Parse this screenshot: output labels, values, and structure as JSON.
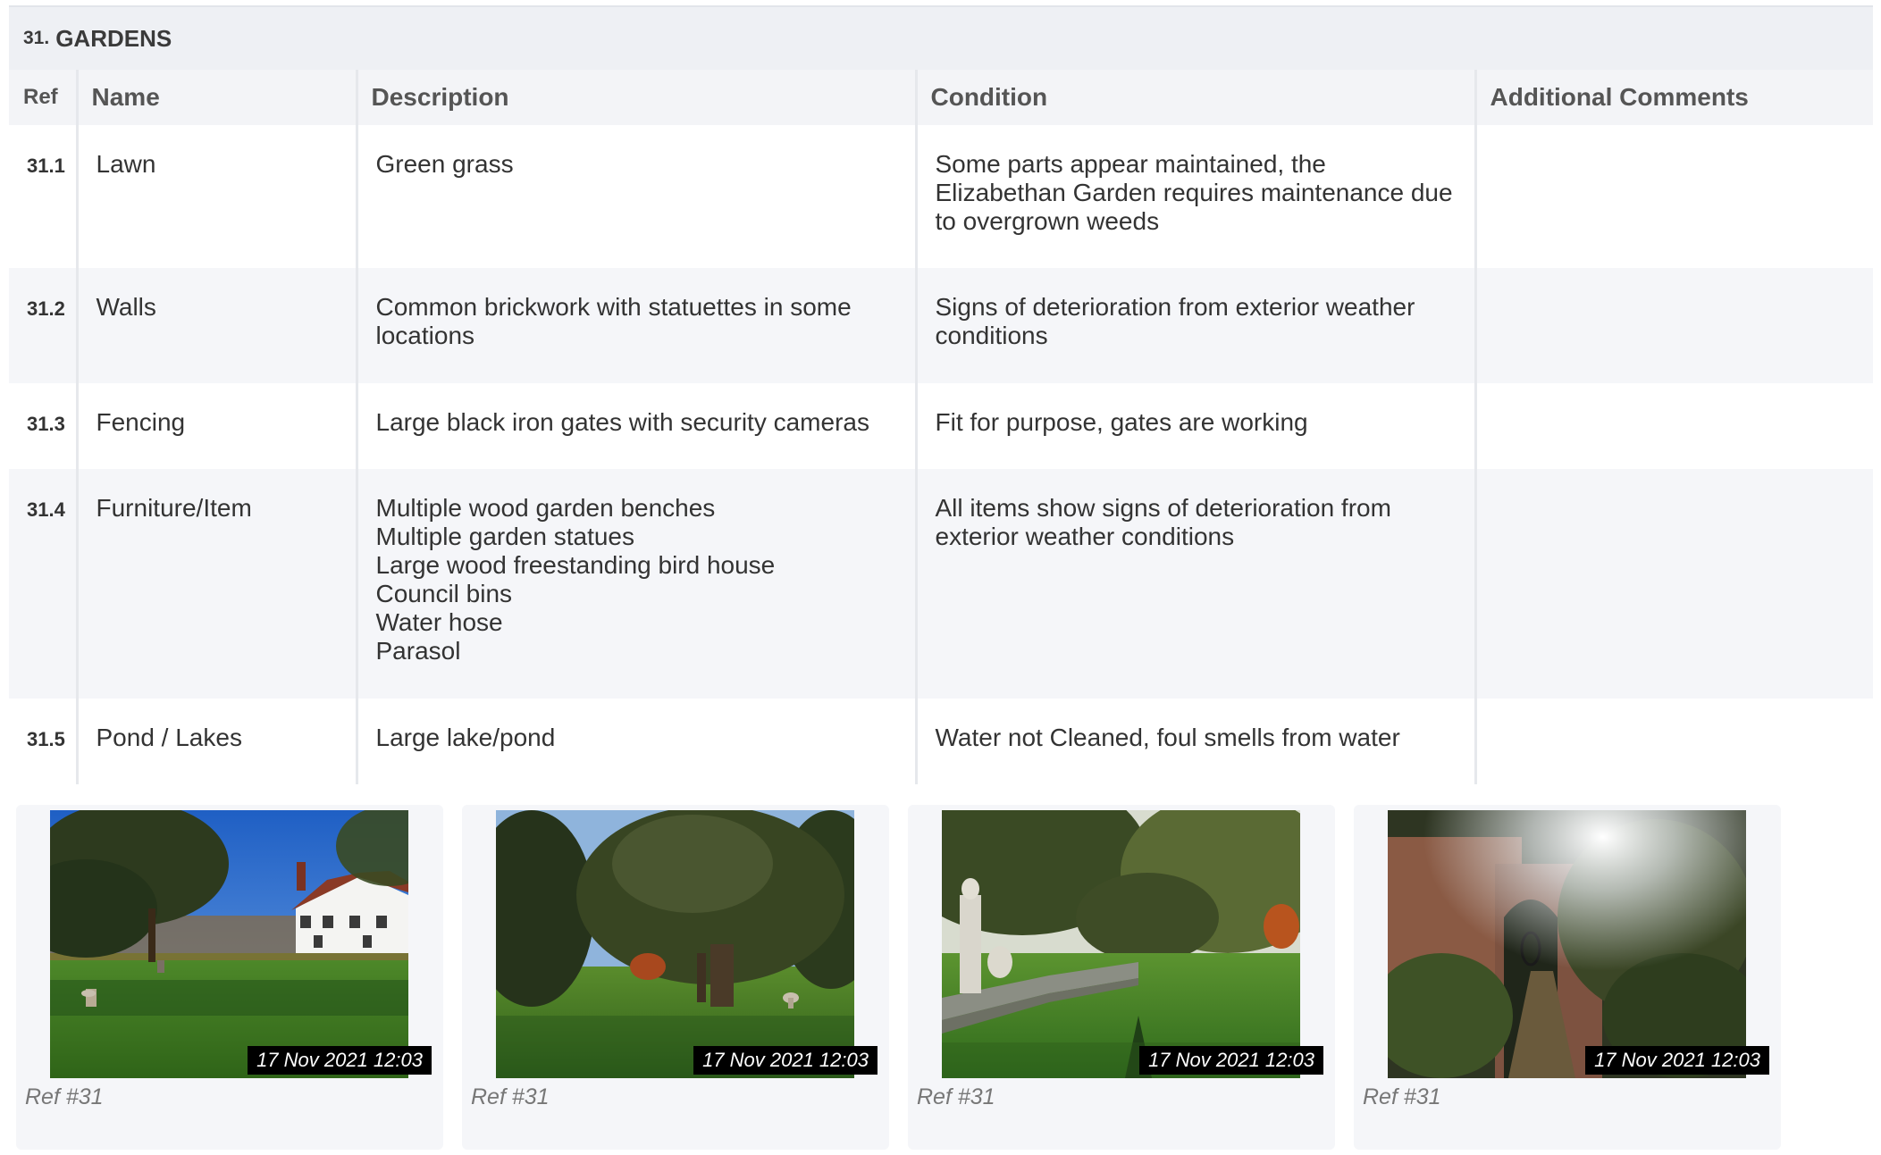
{
  "section": {
    "number": "31.",
    "title": "GARDENS"
  },
  "table": {
    "headers": {
      "ref": "Ref",
      "name": "Name",
      "description": "Description",
      "condition": "Condition",
      "comments": "Additional Comments"
    },
    "rows": [
      {
        "ref": "31.1",
        "name": "Lawn",
        "description": [
          "Green grass"
        ],
        "condition": [
          "Some parts appear maintained, the",
          "Elizabethan Garden requires maintenance due",
          "to overgrown weeds"
        ],
        "comments": ""
      },
      {
        "ref": "31.2",
        "name": "Walls",
        "description": [
          "Common brickwork with statuettes in some",
          "locations"
        ],
        "condition": [
          "Signs of deterioration from exterior weather",
          "conditions"
        ],
        "comments": ""
      },
      {
        "ref": "31.3",
        "name": "Fencing",
        "description": [
          "Large black iron gates with security cameras"
        ],
        "condition": [
          "Fit for purpose, gates are working"
        ],
        "comments": ""
      },
      {
        "ref": "31.4",
        "name": "Furniture/Item",
        "description": [
          "Multiple wood garden benches",
          "Multiple garden statues",
          "Large wood freestanding bird house",
          "Council bins",
          "Water hose",
          "Parasol"
        ],
        "condition": [
          "All items show signs of deterioration from",
          "exterior weather conditions"
        ],
        "comments": ""
      },
      {
        "ref": "31.5",
        "name": "Pond / Lakes",
        "description": [
          "Large lake/pond"
        ],
        "condition": [
          "Water not Cleaned, foul smells from water"
        ],
        "comments": ""
      }
    ]
  },
  "photos": [
    {
      "timestamp": "17 Nov 2021 12:03",
      "ref": "Ref #31"
    },
    {
      "timestamp": "17 Nov 2021 12:03",
      "ref": "Ref #31"
    },
    {
      "timestamp": "17 Nov 2021 12:03",
      "ref": "Ref #31"
    },
    {
      "timestamp": "17 Nov 2021 12:03",
      "ref": "Ref #31"
    }
  ]
}
